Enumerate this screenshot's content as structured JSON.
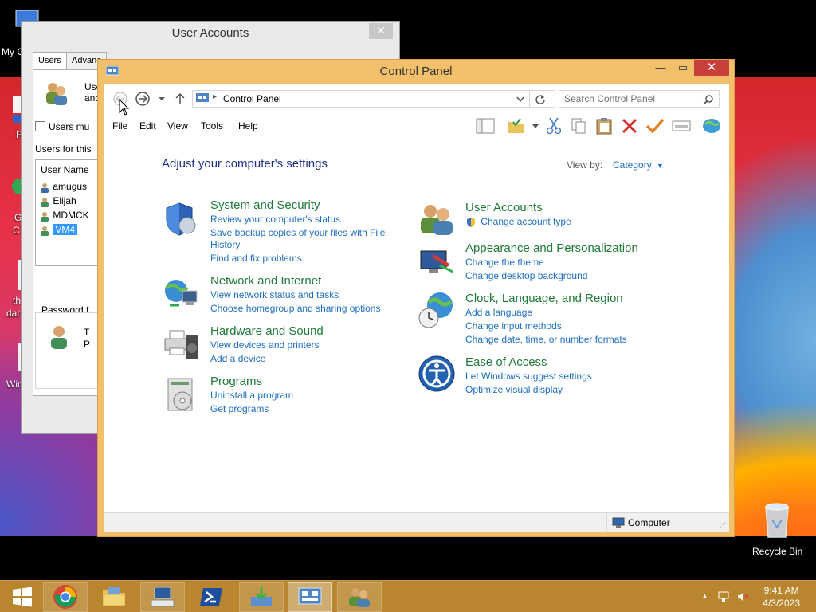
{
  "desktop": {
    "icons": [
      {
        "label": "My C",
        "name": "my-computer"
      },
      {
        "label": "F",
        "name": "desktop-item-f"
      },
      {
        "label": "G",
        "name": "desktop-item-g"
      },
      {
        "label": "C",
        "name": "desktop-item-c"
      },
      {
        "label": "th",
        "name": "desktop-item-th"
      },
      {
        "label": "dar",
        "name": "desktop-item-dar"
      },
      {
        "label": "Wir",
        "name": "desktop-item-wir"
      },
      {
        "label": "Recycle Bin",
        "name": "recycle-bin"
      }
    ]
  },
  "user_accounts": {
    "title": "User Accounts",
    "tabs": [
      "Users",
      "Advanc"
    ],
    "desc_line1": "Use",
    "desc_line2": "and",
    "checkbox_label": "Users mu",
    "users_for_label": "Users for this",
    "column_header": "User Name",
    "users": [
      "amugus",
      "Elijah",
      "MDMCK",
      "VM4"
    ],
    "selected_user": "VM4",
    "password_group": "Password f",
    "password_text1": "T",
    "password_text2": "P"
  },
  "control_panel": {
    "title": "Control Panel",
    "address": "Control Panel",
    "search_placeholder": "Search Control Panel",
    "menu": [
      "File",
      "Edit",
      "View",
      "Tools",
      "Help"
    ],
    "heading": "Adjust your computer's settings",
    "view_by_label": "View by:",
    "view_by_value": "Category",
    "categories_left": [
      {
        "title": "System and Security",
        "links": [
          "Review your computer's status",
          "Save backup copies of your files with File",
          "History",
          "Find and fix problems"
        ]
      },
      {
        "title": "Network and Internet",
        "links": [
          "View network status and tasks",
          "Choose homegroup and sharing options"
        ]
      },
      {
        "title": "Hardware and Sound",
        "links": [
          "View devices and printers",
          "Add a device"
        ]
      },
      {
        "title": "Programs",
        "links": [
          "Uninstall a program",
          "Get programs"
        ]
      }
    ],
    "categories_right": [
      {
        "title": "User Accounts",
        "links": [
          "Change account type"
        ]
      },
      {
        "title": "Appearance and Personalization",
        "links": [
          "Change the theme",
          "Change desktop background"
        ]
      },
      {
        "title": "Clock, Language, and Region",
        "links": [
          "Add a language",
          "Change input methods",
          "Change date, time, or number formats"
        ]
      },
      {
        "title": "Ease of Access",
        "links": [
          "Let Windows suggest settings",
          "Optimize visual display"
        ]
      }
    ],
    "status": "Computer"
  },
  "taskbar": {
    "time": "9:41 AM",
    "date": "4/3/2023"
  }
}
